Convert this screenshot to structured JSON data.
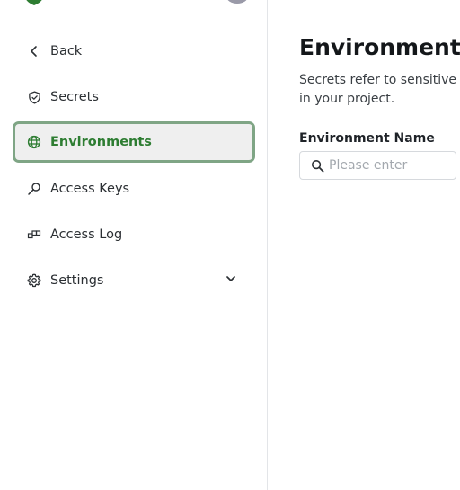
{
  "brand": {
    "accent": "#2e7d32",
    "active_border": "#7fa585",
    "logo_icon": "shield-logo-icon",
    "avatar_color": "#9a9aa8"
  },
  "sidebar": {
    "items": [
      {
        "label": "Back",
        "icon": "chevron-left-icon"
      },
      {
        "label": "Secrets",
        "icon": "shield-check-icon"
      },
      {
        "label": "Environments",
        "icon": "globe-icon",
        "active": true
      },
      {
        "label": "Access Keys",
        "icon": "key-icon"
      },
      {
        "label": "Access Log",
        "icon": "log-blocks-icon"
      },
      {
        "label": "Settings",
        "icon": "gear-icon",
        "expandable": true,
        "expand_icon": "chevron-down-icon"
      }
    ]
  },
  "main": {
    "title": "Environments",
    "description_line1": "Secrets refer to sensitive inf",
    "description_line2": "in your project.",
    "field_label": "Environment Name",
    "search": {
      "placeholder": "Please enter",
      "value": "",
      "icon": "search-icon"
    }
  }
}
